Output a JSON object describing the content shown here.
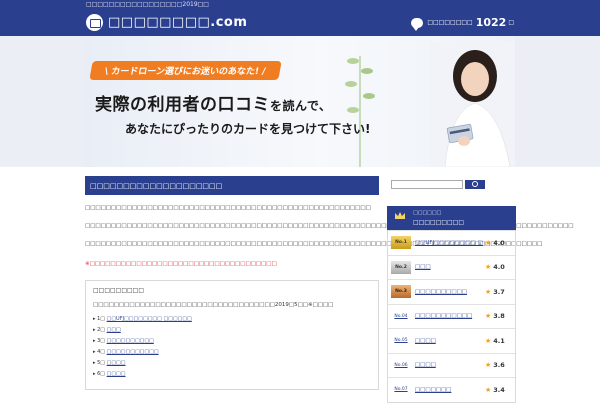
{
  "header": {
    "tagline": "□□□□□□□□□□□□□□□□□2019□□",
    "site_title": "□□□□□□□□.com",
    "counter_label": "□□□□□□□□",
    "counter_value": "1022",
    "counter_unit": "□"
  },
  "hero": {
    "banner": "\\ カードローン選びにお迷いのあなた! /",
    "headline_main": "実際の利用者の口コミ",
    "headline_main_suffix": "を読んで、",
    "headline_sub": "あなたにぴったりのカードを見つけて下さい!"
  },
  "main": {
    "section_title": "□□□□□□□□□□□□□□□□□□□□",
    "paragraph1": "□□□□□□□□□□□□□□□□□□□□□□□□□□□□□□□□□□□□□□□□□□□□□□□□□□□□□□□",
    "paragraph2": "□□□□□□□□□□□□□□□□□□□□□□□□□□□□□□□□□□□□□□□□□□□□□□□□□□□□□□□□□□□□□□□□□□□□□□□□□□□□□□□□□□□□□□□□□□□□□□",
    "paragraph3": "□□□□□□□□□□□□□□□□□□□□□□□□□□□□□□□□□□□□□□□□□□□□□□□□□□□□□□□□□□□□□□□□□□□□□□□□□□□□□□□□□□□□□□□□",
    "notice": "※□□□□□□□□□□□□□□□□□□□□□□□□□□□□□□□□□□□□",
    "toc": {
      "title": "□□□□□□□□□",
      "desc": "□□□□□□□□□□□□□□□□□□□□□□□□□□□□□□□□□□□2019□5□□※□□□□",
      "items": [
        {
          "num": "1□",
          "label": "□□UFJ□□□□□□□□ □□□□□□"
        },
        {
          "num": "2□",
          "label": "□□□"
        },
        {
          "num": "3□",
          "label": "□□□□□□□□□□"
        },
        {
          "num": "4□",
          "label": "□□□□□□□□□□□"
        },
        {
          "num": "5□",
          "label": "□□□□"
        },
        {
          "num": "6□",
          "label": "□□□□"
        }
      ]
    }
  },
  "sidebar": {
    "search_placeholder": "",
    "ranking_subtitle": "□□□□□□",
    "ranking_title": "□□□□□□□□□",
    "rankings": [
      {
        "badge": "No.1",
        "name": "□□UFJ□□□□□□□□ □□□□□□",
        "score": "4.0",
        "type": "gold"
      },
      {
        "badge": "No.2",
        "name": "□□□",
        "score": "4.0",
        "type": "silver"
      },
      {
        "badge": "No.3",
        "name": "□□□□□□□□□□",
        "score": "3.7",
        "type": "bronze"
      },
      {
        "badge": "No.04",
        "name": "□□□□□□□□□□□",
        "score": "3.8",
        "type": "plain"
      },
      {
        "badge": "No.05",
        "name": "□□□□",
        "score": "4.1",
        "type": "plain"
      },
      {
        "badge": "No.06",
        "name": "□□□□",
        "score": "3.6",
        "type": "plain"
      },
      {
        "badge": "No.07",
        "name": "□□□□□□□",
        "score": "3.4",
        "type": "plain"
      }
    ]
  },
  "colors": {
    "brand": "#2b3f8f",
    "accent_orange": "#f07d22",
    "notice_red": "#d2262e",
    "star": "#f0a020"
  }
}
